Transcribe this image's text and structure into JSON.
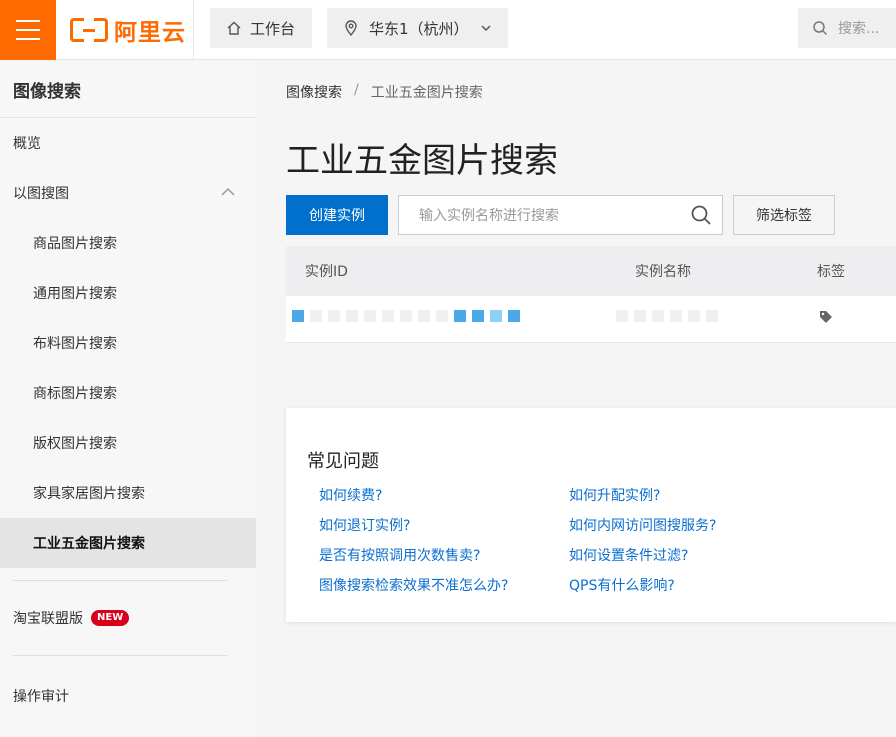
{
  "topbar": {
    "logo_text": "阿里云",
    "workbench_label": "工作台",
    "region_label": "华东1（杭州）",
    "search_placeholder": "搜索..."
  },
  "sidebar": {
    "title": "图像搜索",
    "overview": "概览",
    "group_label": "以图搜图",
    "items": [
      {
        "label": "商品图片搜索"
      },
      {
        "label": "通用图片搜索"
      },
      {
        "label": "布料图片搜索"
      },
      {
        "label": "商标图片搜索"
      },
      {
        "label": "版权图片搜索"
      },
      {
        "label": "家具家居图片搜索"
      },
      {
        "label": "工业五金图片搜索"
      }
    ],
    "taobao_label": "淘宝联盟版",
    "new_badge": "NEW",
    "audit_label": "操作审计"
  },
  "main": {
    "breadcrumb": {
      "root": "图像搜索",
      "separator": "/",
      "current": "工业五金图片搜索"
    },
    "title": "工业五金图片搜索",
    "create_button": "创建实例",
    "search_placeholder": "输入实例名称进行搜索",
    "filter_button": "筛选标签",
    "table": {
      "headers": [
        "实例ID",
        "实例名称",
        "标签"
      ]
    },
    "faq": {
      "title": "常见问题",
      "links": [
        "如何续费?",
        "如何升配实例?",
        "如何退订实例?",
        "如何内网访问图搜服务?",
        "是否有按照调用次数售卖?",
        "如何设置条件过滤?",
        "图像搜索检索效果不准怎么办?",
        "QPS有什么影响?"
      ]
    }
  },
  "colors": {
    "brand": "#ff6a00",
    "primary": "#0070cc",
    "link": "#0b6fd0",
    "new_badge": "#d9001b"
  }
}
